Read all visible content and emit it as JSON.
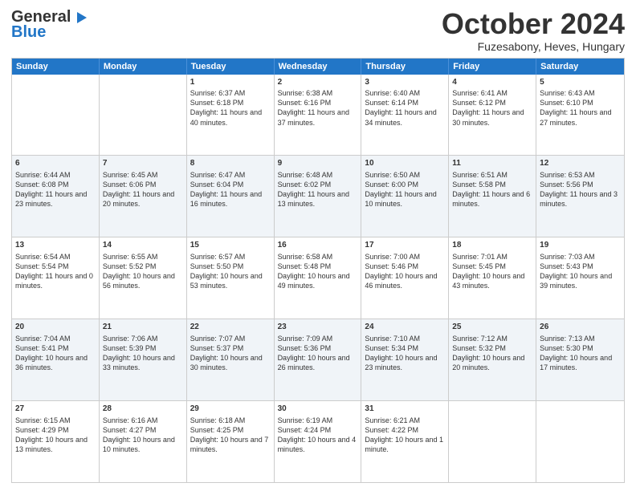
{
  "logo": {
    "line1": "General",
    "line2": "Blue"
  },
  "header": {
    "month": "October 2024",
    "location": "Fuzesabony, Heves, Hungary"
  },
  "weekdays": [
    "Sunday",
    "Monday",
    "Tuesday",
    "Wednesday",
    "Thursday",
    "Friday",
    "Saturday"
  ],
  "rows": [
    [
      {
        "day": "",
        "sunrise": "",
        "sunset": "",
        "daylight": ""
      },
      {
        "day": "",
        "sunrise": "",
        "sunset": "",
        "daylight": ""
      },
      {
        "day": "1",
        "sunrise": "Sunrise: 6:37 AM",
        "sunset": "Sunset: 6:18 PM",
        "daylight": "Daylight: 11 hours and 40 minutes."
      },
      {
        "day": "2",
        "sunrise": "Sunrise: 6:38 AM",
        "sunset": "Sunset: 6:16 PM",
        "daylight": "Daylight: 11 hours and 37 minutes."
      },
      {
        "day": "3",
        "sunrise": "Sunrise: 6:40 AM",
        "sunset": "Sunset: 6:14 PM",
        "daylight": "Daylight: 11 hours and 34 minutes."
      },
      {
        "day": "4",
        "sunrise": "Sunrise: 6:41 AM",
        "sunset": "Sunset: 6:12 PM",
        "daylight": "Daylight: 11 hours and 30 minutes."
      },
      {
        "day": "5",
        "sunrise": "Sunrise: 6:43 AM",
        "sunset": "Sunset: 6:10 PM",
        "daylight": "Daylight: 11 hours and 27 minutes."
      }
    ],
    [
      {
        "day": "6",
        "sunrise": "Sunrise: 6:44 AM",
        "sunset": "Sunset: 6:08 PM",
        "daylight": "Daylight: 11 hours and 23 minutes."
      },
      {
        "day": "7",
        "sunrise": "Sunrise: 6:45 AM",
        "sunset": "Sunset: 6:06 PM",
        "daylight": "Daylight: 11 hours and 20 minutes."
      },
      {
        "day": "8",
        "sunrise": "Sunrise: 6:47 AM",
        "sunset": "Sunset: 6:04 PM",
        "daylight": "Daylight: 11 hours and 16 minutes."
      },
      {
        "day": "9",
        "sunrise": "Sunrise: 6:48 AM",
        "sunset": "Sunset: 6:02 PM",
        "daylight": "Daylight: 11 hours and 13 minutes."
      },
      {
        "day": "10",
        "sunrise": "Sunrise: 6:50 AM",
        "sunset": "Sunset: 6:00 PM",
        "daylight": "Daylight: 11 hours and 10 minutes."
      },
      {
        "day": "11",
        "sunrise": "Sunrise: 6:51 AM",
        "sunset": "Sunset: 5:58 PM",
        "daylight": "Daylight: 11 hours and 6 minutes."
      },
      {
        "day": "12",
        "sunrise": "Sunrise: 6:53 AM",
        "sunset": "Sunset: 5:56 PM",
        "daylight": "Daylight: 11 hours and 3 minutes."
      }
    ],
    [
      {
        "day": "13",
        "sunrise": "Sunrise: 6:54 AM",
        "sunset": "Sunset: 5:54 PM",
        "daylight": "Daylight: 11 hours and 0 minutes."
      },
      {
        "day": "14",
        "sunrise": "Sunrise: 6:55 AM",
        "sunset": "Sunset: 5:52 PM",
        "daylight": "Daylight: 10 hours and 56 minutes."
      },
      {
        "day": "15",
        "sunrise": "Sunrise: 6:57 AM",
        "sunset": "Sunset: 5:50 PM",
        "daylight": "Daylight: 10 hours and 53 minutes."
      },
      {
        "day": "16",
        "sunrise": "Sunrise: 6:58 AM",
        "sunset": "Sunset: 5:48 PM",
        "daylight": "Daylight: 10 hours and 49 minutes."
      },
      {
        "day": "17",
        "sunrise": "Sunrise: 7:00 AM",
        "sunset": "Sunset: 5:46 PM",
        "daylight": "Daylight: 10 hours and 46 minutes."
      },
      {
        "day": "18",
        "sunrise": "Sunrise: 7:01 AM",
        "sunset": "Sunset: 5:45 PM",
        "daylight": "Daylight: 10 hours and 43 minutes."
      },
      {
        "day": "19",
        "sunrise": "Sunrise: 7:03 AM",
        "sunset": "Sunset: 5:43 PM",
        "daylight": "Daylight: 10 hours and 39 minutes."
      }
    ],
    [
      {
        "day": "20",
        "sunrise": "Sunrise: 7:04 AM",
        "sunset": "Sunset: 5:41 PM",
        "daylight": "Daylight: 10 hours and 36 minutes."
      },
      {
        "day": "21",
        "sunrise": "Sunrise: 7:06 AM",
        "sunset": "Sunset: 5:39 PM",
        "daylight": "Daylight: 10 hours and 33 minutes."
      },
      {
        "day": "22",
        "sunrise": "Sunrise: 7:07 AM",
        "sunset": "Sunset: 5:37 PM",
        "daylight": "Daylight: 10 hours and 30 minutes."
      },
      {
        "day": "23",
        "sunrise": "Sunrise: 7:09 AM",
        "sunset": "Sunset: 5:36 PM",
        "daylight": "Daylight: 10 hours and 26 minutes."
      },
      {
        "day": "24",
        "sunrise": "Sunrise: 7:10 AM",
        "sunset": "Sunset: 5:34 PM",
        "daylight": "Daylight: 10 hours and 23 minutes."
      },
      {
        "day": "25",
        "sunrise": "Sunrise: 7:12 AM",
        "sunset": "Sunset: 5:32 PM",
        "daylight": "Daylight: 10 hours and 20 minutes."
      },
      {
        "day": "26",
        "sunrise": "Sunrise: 7:13 AM",
        "sunset": "Sunset: 5:30 PM",
        "daylight": "Daylight: 10 hours and 17 minutes."
      }
    ],
    [
      {
        "day": "27",
        "sunrise": "Sunrise: 6:15 AM",
        "sunset": "Sunset: 4:29 PM",
        "daylight": "Daylight: 10 hours and 13 minutes."
      },
      {
        "day": "28",
        "sunrise": "Sunrise: 6:16 AM",
        "sunset": "Sunset: 4:27 PM",
        "daylight": "Daylight: 10 hours and 10 minutes."
      },
      {
        "day": "29",
        "sunrise": "Sunrise: 6:18 AM",
        "sunset": "Sunset: 4:25 PM",
        "daylight": "Daylight: 10 hours and 7 minutes."
      },
      {
        "day": "30",
        "sunrise": "Sunrise: 6:19 AM",
        "sunset": "Sunset: 4:24 PM",
        "daylight": "Daylight: 10 hours and 4 minutes."
      },
      {
        "day": "31",
        "sunrise": "Sunrise: 6:21 AM",
        "sunset": "Sunset: 4:22 PM",
        "daylight": "Daylight: 10 hours and 1 minute."
      },
      {
        "day": "",
        "sunrise": "",
        "sunset": "",
        "daylight": ""
      },
      {
        "day": "",
        "sunrise": "",
        "sunset": "",
        "daylight": ""
      }
    ]
  ],
  "alt_rows": [
    1,
    3
  ]
}
